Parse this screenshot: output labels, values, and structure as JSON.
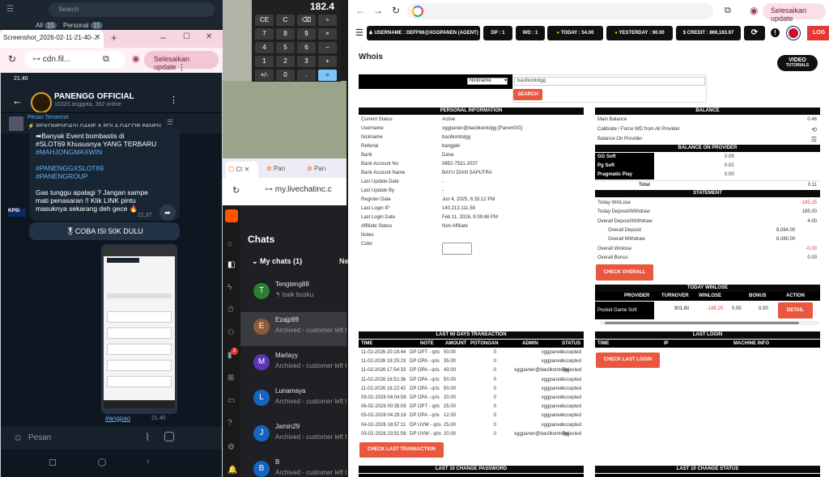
{
  "left_app": {
    "search_placeholder": "Search",
    "tabs": [
      {
        "label": "All",
        "count": "15"
      },
      {
        "label": "Personal",
        "count": "15"
      }
    ]
  },
  "screenshot_window": {
    "tab_title": "Screenshot_2026-02-11-21-40-...",
    "url": "cdn.fil...",
    "update_label": "Selesaikan update"
  },
  "telegram": {
    "time": "21.40",
    "channel_name": "PANENGG OFFICIAL",
    "channel_meta": "10320 anggota, 362 online",
    "pinned_title": "Pesan Tersemat",
    "pinned_text": "⚡ REKOMENDASI GAME & POLA GACOR PANEN...",
    "message_lines": [
      "➡Banyak Event bombastis di",
      "#SLOT69 Khususnya YANG TERBARU",
      "#MAHJONGMAXWIN",
      "",
      "#PANENGGXSLOT69",
      "#PANENGROUP",
      "",
      "Gas tunggu apalagi ? Jangan sampe",
      "mati penasaran !! Klik LINK pintu",
      "masuknya sekarang deh gece 🔥"
    ],
    "message_time": "21.37",
    "cta_button": "🎖COBA ISI 50K DULU",
    "photo_caption": "#angpao",
    "photo_time": "21.40",
    "input_placeholder": "Pesan",
    "side_badge": "KPSI"
  },
  "calculator": {
    "display": "182.4",
    "keys": [
      "CE",
      "C",
      "⌫",
      "÷",
      "7",
      "8",
      "9",
      "×",
      "4",
      "5",
      "6",
      "−",
      "1",
      "2",
      "3",
      "+",
      "+/-",
      "0",
      ".",
      "="
    ]
  },
  "livechat": {
    "tabs": [
      "Ct",
      "Pan",
      "Pan"
    ],
    "url": "my.livechatinc.c",
    "section_title": "Chats",
    "my_chats_label": "My chats (1)",
    "my_chats_next": "Ne",
    "badge_count": "2",
    "chats": [
      {
        "initial": "T",
        "name": "Tengteng88",
        "subtitle": "↰ baik bosku",
        "color": "#2e7d32"
      },
      {
        "initial": "E",
        "name": "Ezajp99",
        "subtitle": "Archived - customer left t",
        "color": "#8d5a3a"
      },
      {
        "initial": "M",
        "name": "Marlayy",
        "subtitle": "Archived - customer left t",
        "color": "#5e35b1"
      },
      {
        "initial": "L",
        "name": "Lunamaya",
        "subtitle": "Archived - customer left t",
        "color": "#1565c0"
      },
      {
        "initial": "J",
        "name": "Jamin29",
        "subtitle": "Archived - customer left t",
        "color": "#1565c0"
      },
      {
        "initial": "B",
        "name": "B",
        "subtitle": "Archived - customer left t",
        "color": "#1565c0"
      }
    ]
  },
  "main_browser": {
    "update_label": "Selesaikan update",
    "nav_pills": [
      {
        "label": "USERNAME : DEFF66@XGGPANEN (AGENT)"
      },
      {
        "label": "DP : 1"
      },
      {
        "label": "WD : 1"
      },
      {
        "label": "TODAY : 54.00"
      },
      {
        "label": "YESTERDAY : 90.00"
      },
      {
        "label": "CREDIT : 866,163.97"
      }
    ],
    "logout_label": "LOG",
    "page_title": "Whois",
    "video_badge_line1": "VIDEO",
    "video_badge_line2": "TUTORIALS",
    "search": {
      "select_value": "Nickname",
      "input_value": "bacilkontolgg",
      "button": "SEARCH"
    },
    "personal_info": {
      "header": "PERSONAL INFORMATION",
      "rows": [
        {
          "label": "Current Status",
          "value": "Active"
        },
        {
          "label": "Username",
          "value": "xggpanen@bacilkontolgg  [PanenGG]"
        },
        {
          "label": "Nickname",
          "value": "bacilkontolgg"
        },
        {
          "label": "Referral",
          "value": "bangjeki"
        },
        {
          "label": "Bank",
          "value": "Dana"
        },
        {
          "label": "Bank Account No",
          "value": "0852-7531-2037"
        },
        {
          "label": "Bank Account Name",
          "value": "BAYU DIAN SAPUTRA"
        },
        {
          "label": "Last Update Date",
          "value": "-"
        },
        {
          "label": "Last Update By",
          "value": "-"
        },
        {
          "label": "Register Date",
          "value": "Jun 4, 2025, 6:33:12 PM"
        },
        {
          "label": "Last Login IP",
          "value": "140.213.111.58"
        },
        {
          "label": "Last Login Date",
          "value": "Feb 11, 2026, 9:39:48 PM"
        },
        {
          "label": "Affiliate Status",
          "value": "Non Affiliate"
        },
        {
          "label": "Notes",
          "value": ""
        },
        {
          "label": "Color",
          "value": ""
        }
      ]
    },
    "balance": {
      "header": "BALANCE",
      "rows": [
        {
          "label": "Main Balance",
          "value": "0.46"
        },
        {
          "label": "Calibrate / Force WD from All Provider",
          "value": "⟲"
        },
        {
          "label": "Balance On Provider",
          "value": "☰"
        }
      ],
      "provider_header": "BALANCE ON PROVIDER",
      "providers": [
        {
          "name": "GG Soft",
          "value": "0.09"
        },
        {
          "name": "Pg Soft",
          "value": "0.02"
        },
        {
          "name": "Pragmatic Play",
          "value": "0.00"
        }
      ],
      "total_label": "Total",
      "total_value": "0.11"
    },
    "statement": {
      "header": "STATEMENT",
      "rows": [
        {
          "label": "Today WinLose",
          "value": "-185.25",
          "negative": true
        },
        {
          "label": "Today Deposit/Withdraw",
          "value": "185.00"
        },
        {
          "label": "Overall Deposit/Withdraw",
          "value": "4.00"
        },
        {
          "label": "Overall Deposit",
          "value": "6,084.00",
          "indent": true
        },
        {
          "label": "Overall Withdraw",
          "value": "6,080.00",
          "indent": true
        },
        {
          "label": "Overall Winlose",
          "value": "-0.00",
          "negative": true
        },
        {
          "label": "Overall Bonus",
          "value": "0.00"
        }
      ],
      "button": "CHECK OVERALL"
    },
    "today_winlose": {
      "header": "TODAY WINLOSE",
      "columns": [
        "PROVIDER",
        "TURNOVER",
        "WINLOSE",
        "BONUS",
        "ACTION"
      ],
      "row": {
        "provider": "Pocket Game Soft",
        "turnover": "901.80",
        "winlose": "-185.25",
        "bonus": "0.00",
        "extra": "0.00",
        "action": "DETAIL"
      }
    },
    "last_login": {
      "header": "LAST LOGIN",
      "columns": [
        "TIME",
        "IP",
        "MACHINE INFO"
      ],
      "button": "CHECK LAST LOGIN"
    },
    "transactions": {
      "header": "LAST 60 DAYS TRANSACTION",
      "columns": [
        "TIME",
        "NOTE",
        "AMOUNT",
        "POTONGAN",
        "ADMIN",
        "STATUS"
      ],
      "rows": [
        {
          "time": "11-02-2026 20:18:44",
          "note": "DP OPT - qris",
          "amount": "50.00",
          "potongan": "0",
          "admin": "xggpanen",
          "status": "Accepted"
        },
        {
          "time": "11-02-2026 18:25:23",
          "note": "DP OPA - qris",
          "amount": "35.00",
          "potongan": "0",
          "admin": "xggpanen",
          "status": "Accepted"
        },
        {
          "time": "11-02-2026 17:54:33",
          "note": "DP OPA - qris",
          "amount": "43.00",
          "potongan": "0",
          "admin": "xggpanen@bacilkontolgg",
          "status": "Rejected"
        },
        {
          "time": "11-02-2026 16:51:36",
          "note": "DP OPA - qris",
          "amount": "50.00",
          "potongan": "0",
          "admin": "xggpanen",
          "status": "Accepted"
        },
        {
          "time": "11-02-2026 16:22:42",
          "note": "DP OPA - qris",
          "amount": "50.00",
          "potongan": "0",
          "admin": "xggpanen",
          "status": "Accepted"
        },
        {
          "time": "09-02-2026 04:04:58",
          "note": "DP OPA - qris",
          "amount": "20.00",
          "potongan": "0",
          "admin": "xggpanen",
          "status": "Accepted"
        },
        {
          "time": "06-02-2026 00:35:08",
          "note": "DP OPT - qris",
          "amount": "25.00",
          "potongan": "0",
          "admin": "xggpanen",
          "status": "Accepted"
        },
        {
          "time": "05-02-2026 04:29:16",
          "note": "DP OPA - qris",
          "amount": "12.00",
          "potongan": "0",
          "admin": "xggpanen",
          "status": "Accepted"
        },
        {
          "time": "04-02-2026 16:57:11",
          "note": "DP UVW - qris",
          "amount": "25.00",
          "potongan": "0",
          "admin": "xggpanen",
          "status": "Accepted"
        },
        {
          "time": "03-02-2026 23:51:56",
          "note": "DP UVW - qris",
          "amount": "20.00",
          "potongan": "0",
          "admin": "xggpanen@bacilkontolgg",
          "status": "Rejected"
        }
      ],
      "button": "CHECK LAST TRANSACTION"
    },
    "change_password": {
      "header": "LAST 10 CHANGE PASSWORD"
    },
    "change_status": {
      "header": "LAST 10 CHANGE STATUS"
    }
  },
  "colors": {
    "accent_orange": "#e9573f",
    "negative": "#e53935",
    "telegram_bg": "#0e1621"
  }
}
